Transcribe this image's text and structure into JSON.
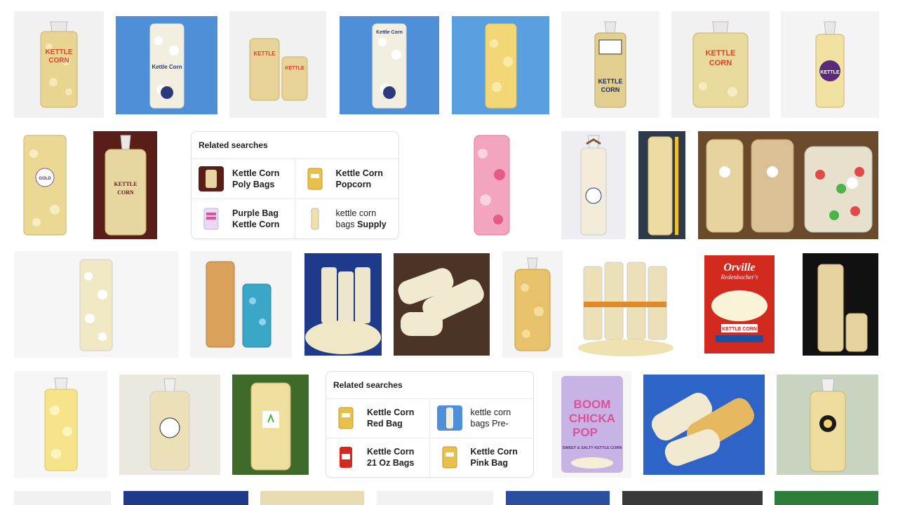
{
  "colors": {
    "popcorn": "#efe2a8",
    "popcorn_dark": "#c9b26a",
    "blue_bg": "#4f8fd8",
    "label_red": "#d8452b",
    "label_purple": "#5b2a7a",
    "pink_pop": "#f08fae",
    "blue_pop": "#3aa6c8",
    "box_red": "#d32a1f",
    "chicka_purple": "#c8b4e4"
  },
  "related_1": {
    "title": "Related searches",
    "items": [
      {
        "line1": "Kettle Corn",
        "line2": "Poly Bags",
        "bold": "both",
        "thumb": "brown-bag-icon"
      },
      {
        "line1": "Kettle Corn",
        "line2": "Popcorn",
        "bold": "both",
        "thumb": "yellow-bag-icon"
      },
      {
        "line1": "Purple Bag",
        "line2": "Kettle Corn",
        "bold": "both",
        "thumb": "chicka-bag-icon"
      },
      {
        "line1": "kettle corn",
        "line2": "bags ",
        "line2_bold": "Supply",
        "bold": "partial",
        "thumb": "clear-bag-icon"
      }
    ]
  },
  "related_2": {
    "title": "Related searches",
    "items": [
      {
        "line1": "Kettle Corn",
        "line2": "Red Bag",
        "bold": "both",
        "thumb": "yellow-bag-icon"
      },
      {
        "line1": "kettle corn",
        "line2": "bags Pre-",
        "bold": "none",
        "thumb": "blue-clear-bag-icon"
      },
      {
        "line1": "Kettle Corn",
        "line2": "21 Oz Bags",
        "bold": "both",
        "thumb": "red-bag-icon"
      },
      {
        "line1": "Kettle Corn",
        "line2": "Pink Bag",
        "bold": "both",
        "thumb": "yellow-bag-icon"
      }
    ]
  },
  "image_labels": {
    "kettle_corn": "KETTLE CORN",
    "orville_brand": "Orville",
    "orville_sub": "Redenbacher's",
    "orville_flavor": "KETTLE CORN",
    "boom": "BOOM",
    "chicka": "CHICKA",
    "pop": "POP",
    "chicka_flavor": "SWEET & SALTY KETTLE CORN"
  }
}
